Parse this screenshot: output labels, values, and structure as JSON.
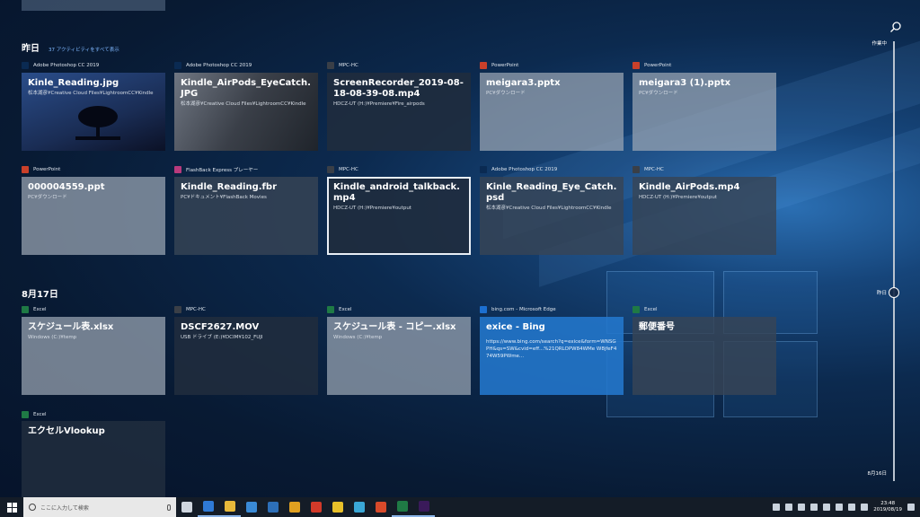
{
  "yesterday": {
    "title": "昨日",
    "activity_link": "37 アクティビティをすべて表示"
  },
  "aug17": {
    "title": "8月17日"
  },
  "rows": [
    [
      {
        "app": "Adobe Photoshop CC 2019",
        "app_color": "#0a2a52",
        "title": "Kinle_Reading.jpg",
        "sub": "松本湖彦¥Creative Cloud Files¥LightroomCC¥Kindle",
        "style": "photo"
      },
      {
        "app": "Adobe Photoshop CC 2019",
        "app_color": "#0a2a52",
        "title": "Kindle_AirPods_EyeCatch.JPG",
        "sub": "松本湖彦¥Creative Cloud Files¥LightroomCC¥Kindle",
        "style": "phone"
      },
      {
        "app": "MPC-HC",
        "app_color": "#3a3f47",
        "title": "ScreenRecorder_2019-08-18-08-39-08.mp4",
        "sub": "HDCZ-UT (H:)¥Premiere¥Fire_airpods",
        "style": "dark"
      },
      {
        "app": "PowerPoint",
        "app_color": "#c9402a",
        "title": "meigara3.pptx",
        "sub": "PC¥ダウンロード",
        "style": "light"
      },
      {
        "app": "PowerPoint",
        "app_color": "#c9402a",
        "title": "meigara3 (1).pptx",
        "sub": "PC¥ダウンロード",
        "style": "light"
      }
    ],
    [
      {
        "app": "PowerPoint",
        "app_color": "#c9402a",
        "title": "000004559.ppt",
        "sub": "PC¥ダウンロード",
        "style": "light"
      },
      {
        "app": "FlashBack Express プレーヤー",
        "app_color": "#b83a7c",
        "title": "Kindle_Reading.fbr",
        "sub": "PC¥ドキュメント¥FlashBack Movies",
        "style": "normal"
      },
      {
        "app": "MPC-HC",
        "app_color": "#3a3f47",
        "title": "Kindle_android_talkback.mp4",
        "sub": "HDCZ-UT (H:)¥Premiere¥output",
        "style": "selected"
      },
      {
        "app": "Adobe Photoshop CC 2019",
        "app_color": "#0a2a52",
        "title": "Kinle_Reading_Eye_Catch.psd",
        "sub": "松本湖彦¥Creative Cloud Files¥LightroomCC¥Kindle",
        "style": "normal"
      },
      {
        "app": "MPC-HC",
        "app_color": "#3a3f47",
        "title": "Kindle_AirPods.mp4",
        "sub": "HDCZ-UT (H:)¥Premiere¥output",
        "style": "normal"
      }
    ],
    [
      {
        "app": "Excel",
        "app_color": "#1f7a45",
        "title": "スケジュール表.xlsx",
        "sub": "Windows (C:)¥temp",
        "style": "light"
      },
      {
        "app": "MPC-HC",
        "app_color": "#3a3f47",
        "title": "DSCF2627.MOV",
        "sub": "USB ドライブ (E:)¥DCIM¥102_FUJI",
        "style": "dark"
      },
      {
        "app": "Excel",
        "app_color": "#1f7a45",
        "title": "スケジュール表 - コピー.xlsx",
        "sub": "Windows (C:)¥temp",
        "style": "light"
      },
      {
        "app": "bing.com - Microsoft Edge",
        "app_color": "#1c6fd0",
        "title": "exice - Bing",
        "sub": "",
        "body": "https://www.bing.com/search?q=exice&form=WNSGPH&qs=SW&cvid=eff...%21QRLOPW84WMe W8jfeF474W59PWme...",
        "style": "blue"
      },
      {
        "app": "Excel",
        "app_color": "#1f7a45",
        "title": "郵便番号",
        "sub": "",
        "style": "normal"
      }
    ],
    [
      {
        "app": "Excel",
        "app_color": "#1f7a45",
        "title": "エクセルVlookup",
        "sub": "",
        "style": "dark"
      }
    ]
  ],
  "timeline": {
    "now": "作業中",
    "yesterday": "昨日",
    "aug16": "8月16日"
  },
  "taskbar": {
    "search_placeholder": "ここに入力して検索",
    "time": "23:48",
    "date": "2019/08/19",
    "apps": [
      "task-view",
      "edge",
      "explorer",
      "store",
      "photos",
      "winamp",
      "pdf",
      "chrome",
      "ie",
      "record",
      "excel",
      "premiere"
    ],
    "app_colors": [
      "#cfd6df",
      "#2f7ad6",
      "#e8b93a",
      "#3a8ad6",
      "#2d6fb8",
      "#e0a020",
      "#d23a2a",
      "#e8c02a",
      "#3aa7d6",
      "#d84a2a",
      "#1f7a45",
      "#3a1a5a"
    ]
  }
}
